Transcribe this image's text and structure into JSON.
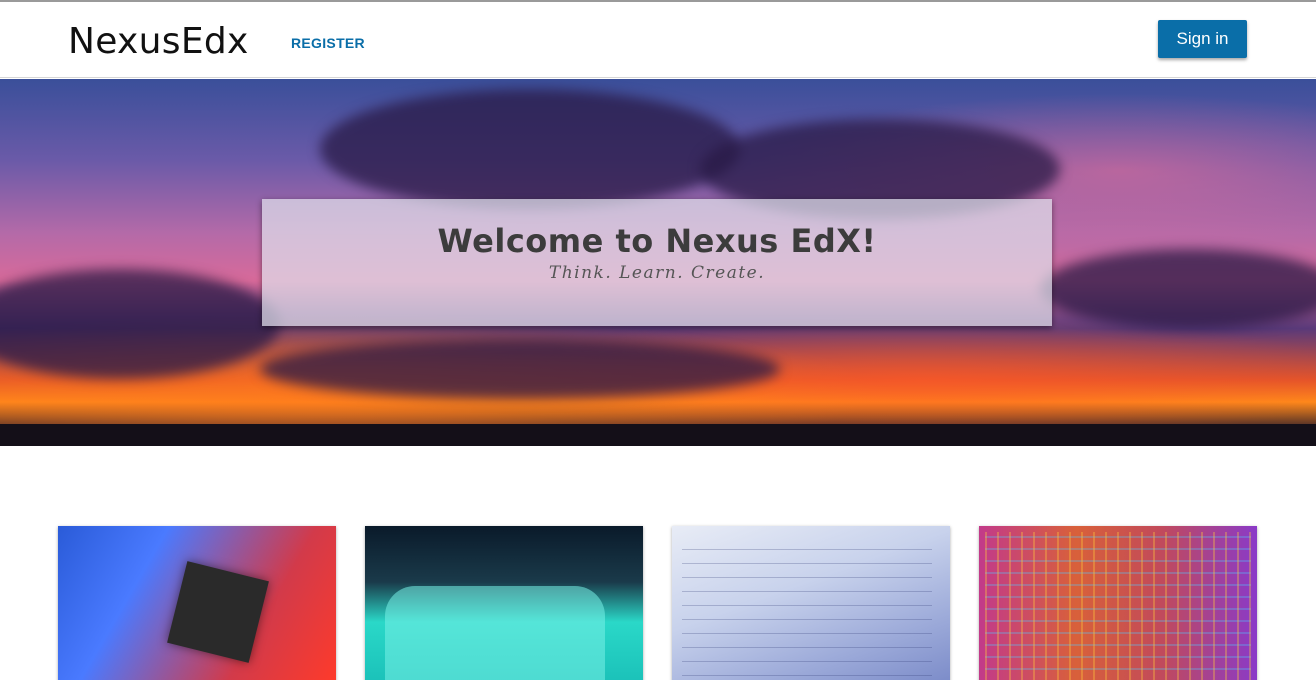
{
  "header": {
    "logo": "NexusEdx",
    "register_label": "REGISTER",
    "signin_label": "Sign in"
  },
  "hero": {
    "title": "Welcome to Nexus EdX!",
    "subtitle": "Think. Learn. Create."
  },
  "colors": {
    "accent": "#0a6ea8",
    "header_bg": "#ffffff"
  },
  "cards": [
    {
      "image": "circuit-board-image"
    },
    {
      "image": "turbine-image"
    },
    {
      "image": "math-notes-image"
    },
    {
      "image": "processor-die-image"
    }
  ]
}
